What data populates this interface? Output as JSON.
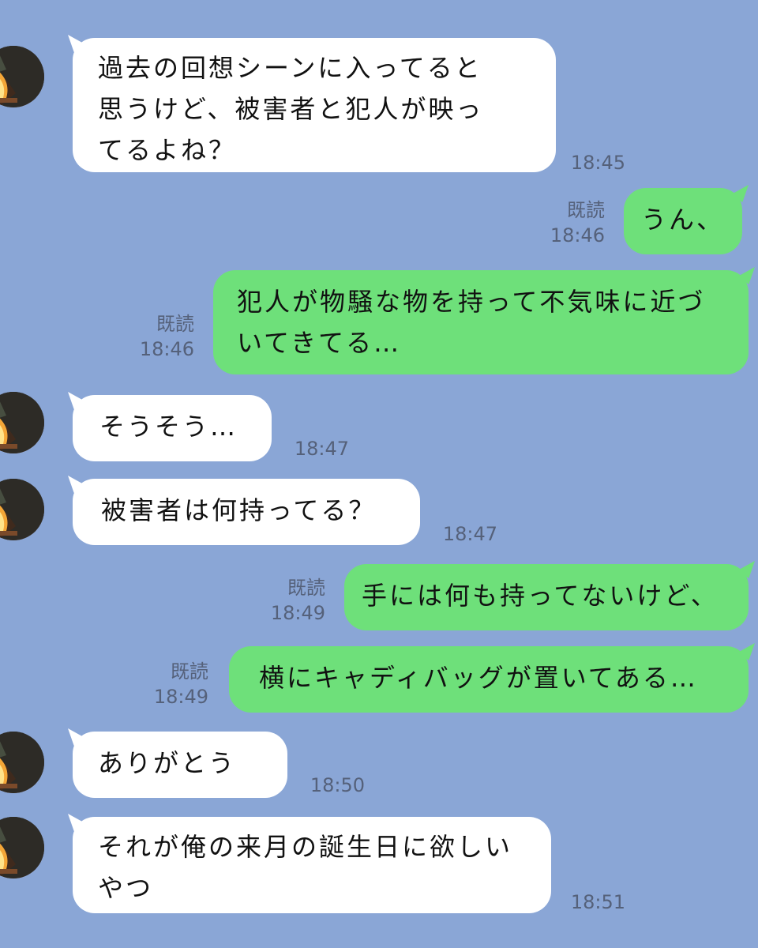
{
  "messages": [
    {
      "side": "in",
      "text": "過去の回想シーンに入ってると\n思うけど、被害者と犯人が映っ\nてるよね？",
      "time": "18:45"
    },
    {
      "side": "out",
      "text": "うん、",
      "read": "既読",
      "time": "18:46"
    },
    {
      "side": "out",
      "text": "犯人が物騒な物を持って不気味に近づ\nいてきてる…",
      "read": "既読",
      "time": "18:46"
    },
    {
      "side": "in",
      "text": "そうそう…",
      "time": "18:47"
    },
    {
      "side": "in",
      "text": "被害者は何持ってる？",
      "time": "18:47"
    },
    {
      "side": "out",
      "text": "手には何も持ってないけど、",
      "read": "既読",
      "time": "18:49"
    },
    {
      "side": "out",
      "text": "横にキャディバッグが置いてある…",
      "read": "既読",
      "time": "18:49"
    },
    {
      "side": "in",
      "text": "ありがとう",
      "time": "18:50"
    },
    {
      "side": "in",
      "text": "それが俺の来月の誕生日に欲しい\nやつ",
      "time": "18:51"
    }
  ],
  "colors": {
    "background": "#8aa6d6",
    "incoming_bubble": "#ffffff",
    "outgoing_bubble": "#6ee07a",
    "meta_text": "#55617a"
  },
  "icons": {
    "avatar": "campfire-avatar-icon"
  }
}
